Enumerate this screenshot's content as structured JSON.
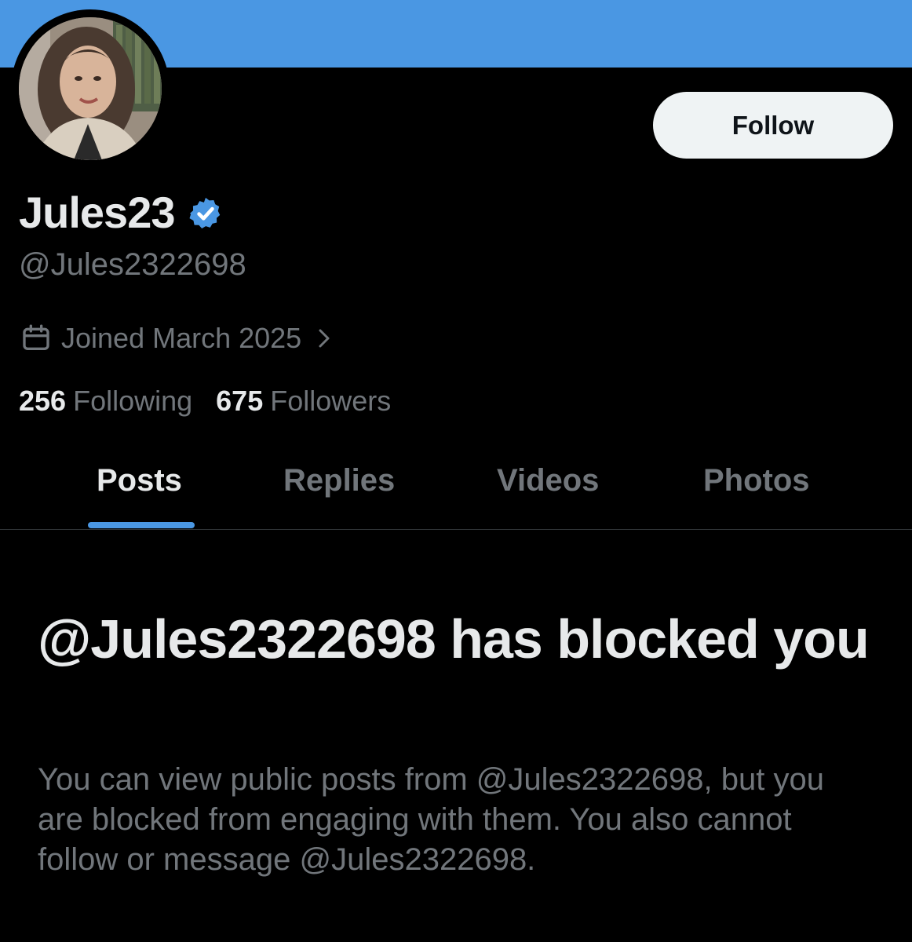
{
  "banner": {
    "color": "#4a97e3"
  },
  "profile": {
    "display_name": "Jules23",
    "verified": true,
    "handle": "@Jules2322698",
    "joined": "Joined March 2025",
    "follow_label": "Follow",
    "stats": {
      "following_count": "256",
      "following_label": "Following",
      "followers_count": "675",
      "followers_label": "Followers"
    }
  },
  "tabs": [
    {
      "label": "Posts",
      "active": true
    },
    {
      "label": "Replies",
      "active": false
    },
    {
      "label": "Videos",
      "active": false
    },
    {
      "label": "Photos",
      "active": false
    }
  ],
  "blocked": {
    "title": "@Jules2322698 has blocked you",
    "message": "You can view public posts from @Jules2322698, but you are blocked from engaging with them. You also cannot follow or message @Jules2322698."
  },
  "icons": {
    "verified": "verified-badge-icon",
    "calendar": "calendar-icon",
    "chevron": "chevron-right-icon"
  },
  "colors": {
    "accent": "#4a97e3",
    "background": "#000000",
    "text_primary": "#e7e9ea",
    "text_secondary": "#71767b"
  }
}
